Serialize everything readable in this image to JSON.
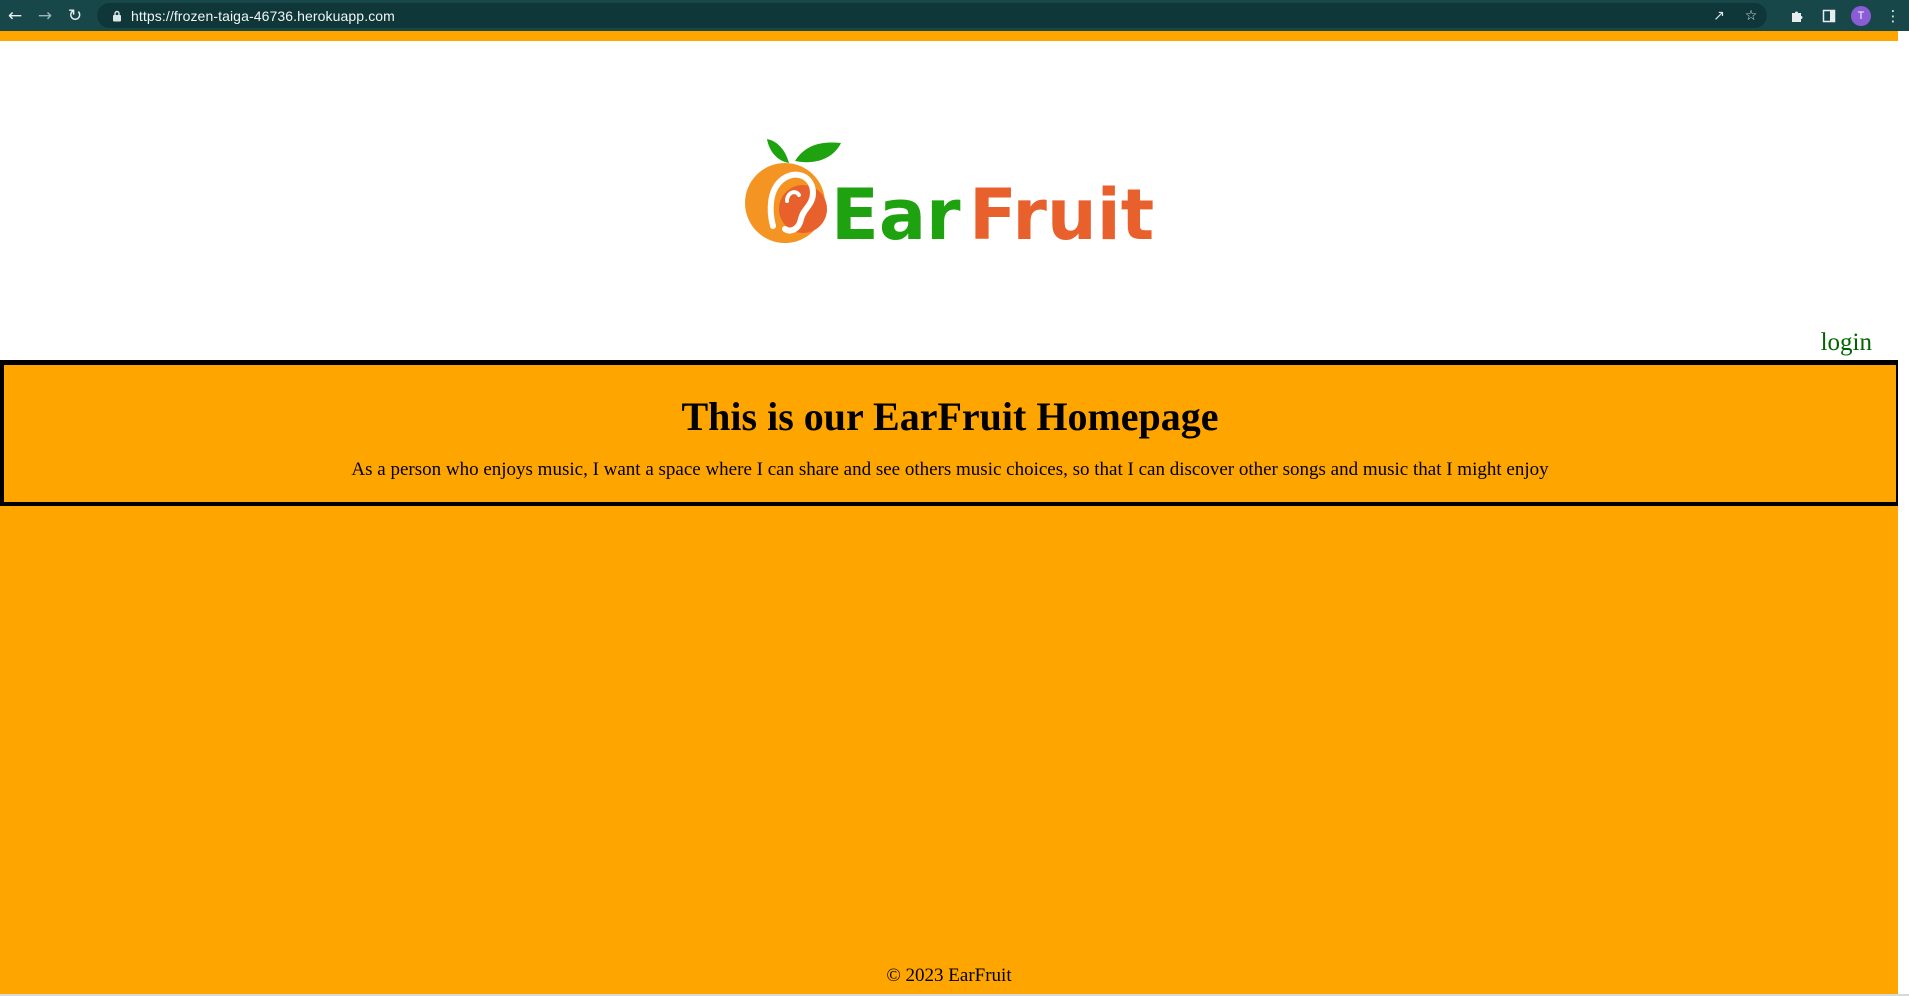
{
  "browser": {
    "url": "https://frozen-taiga-46736.herokuapp.com",
    "avatar_initial": "T",
    "icons": [
      "back-icon",
      "forward-icon",
      "reload-icon",
      "lock-icon",
      "share-icon",
      "star-icon",
      "extensions-icon",
      "side-panel-icon",
      "menu-icon"
    ]
  },
  "header": {
    "logo_text": "EarFruit",
    "login_label": "login"
  },
  "banner": {
    "title": "This is our EarFruit Homepage",
    "description": "As a person who enjoys music, I want a space where I can share and see others music choices, so that I can discover other songs and music that I might enjoy"
  },
  "footer": {
    "copyright": "© 2023 EarFruit"
  },
  "colors": {
    "page_background": "#ffa500",
    "browser_toolbar": "#18474a",
    "logo_green": "#1ea20f",
    "logo_orange": "#e8602c",
    "login_link": "#006400"
  }
}
